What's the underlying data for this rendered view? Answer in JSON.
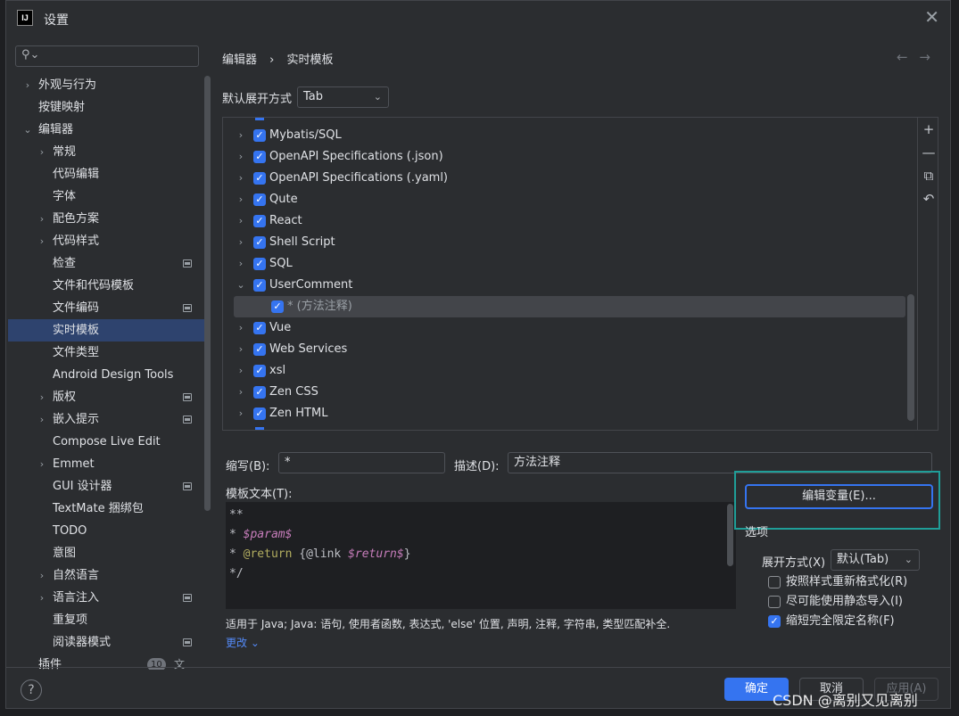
{
  "window": {
    "title": "设置",
    "app_icon_text": "IJ",
    "close_glyph": "✕"
  },
  "search": {
    "icon": "search-icon"
  },
  "sidebar": {
    "items": [
      {
        "label": "外观与行为",
        "chev": "›",
        "indent": 0,
        "proj": false
      },
      {
        "label": "按键映射",
        "chev": "",
        "indent": 0,
        "proj": false
      },
      {
        "label": "编辑器",
        "chev": "⌄",
        "indent": 0,
        "proj": false
      },
      {
        "label": "常规",
        "chev": "›",
        "indent": 1,
        "proj": false
      },
      {
        "label": "代码编辑",
        "chev": "",
        "indent": 1,
        "proj": false
      },
      {
        "label": "字体",
        "chev": "",
        "indent": 1,
        "proj": false
      },
      {
        "label": "配色方案",
        "chev": "›",
        "indent": 1,
        "proj": false
      },
      {
        "label": "代码样式",
        "chev": "›",
        "indent": 1,
        "proj": false
      },
      {
        "label": "检查",
        "chev": "",
        "indent": 1,
        "proj": true
      },
      {
        "label": "文件和代码模板",
        "chev": "",
        "indent": 1,
        "proj": false
      },
      {
        "label": "文件编码",
        "chev": "",
        "indent": 1,
        "proj": true
      },
      {
        "label": "实时模板",
        "chev": "",
        "indent": 1,
        "proj": false,
        "selected": true
      },
      {
        "label": "文件类型",
        "chev": "",
        "indent": 1,
        "proj": false
      },
      {
        "label": "Android Design Tools",
        "chev": "",
        "indent": 1,
        "proj": false
      },
      {
        "label": "版权",
        "chev": "›",
        "indent": 1,
        "proj": true
      },
      {
        "label": "嵌入提示",
        "chev": "›",
        "indent": 1,
        "proj": true
      },
      {
        "label": "Compose Live Edit",
        "chev": "",
        "indent": 1,
        "proj": false
      },
      {
        "label": "Emmet",
        "chev": "›",
        "indent": 1,
        "proj": false
      },
      {
        "label": "GUI 设计器",
        "chev": "",
        "indent": 1,
        "proj": true
      },
      {
        "label": "TextMate 捆绑包",
        "chev": "",
        "indent": 1,
        "proj": false
      },
      {
        "label": "TODO",
        "chev": "",
        "indent": 1,
        "proj": false
      },
      {
        "label": "意图",
        "chev": "",
        "indent": 1,
        "proj": false
      },
      {
        "label": "自然语言",
        "chev": "›",
        "indent": 1,
        "proj": false
      },
      {
        "label": "语言注入",
        "chev": "›",
        "indent": 1,
        "proj": true
      },
      {
        "label": "重复项",
        "chev": "",
        "indent": 1,
        "proj": false
      },
      {
        "label": "阅读器模式",
        "chev": "",
        "indent": 1,
        "proj": true
      },
      {
        "label": "插件",
        "chev": "",
        "indent": 0,
        "proj": false,
        "badge": "10",
        "extra": "文"
      }
    ]
  },
  "breadcrumb": {
    "parent": "编辑器",
    "separator": "›",
    "current": "实时模板"
  },
  "nav": {
    "back": "←",
    "forward": "→"
  },
  "expand": {
    "label": "默认展开方式",
    "value": "Tab",
    "arrow": "⌄"
  },
  "template_list": {
    "rows": [
      {
        "label": "Mybatis/SQL",
        "chev": "›",
        "level": 0
      },
      {
        "label": "OpenAPI Specifications (.json)",
        "chev": "›",
        "level": 0
      },
      {
        "label": "OpenAPI Specifications (.yaml)",
        "chev": "›",
        "level": 0
      },
      {
        "label": "Qute",
        "chev": "›",
        "level": 0
      },
      {
        "label": "React",
        "chev": "›",
        "level": 0
      },
      {
        "label": "Shell Script",
        "chev": "›",
        "level": 0
      },
      {
        "label": "SQL",
        "chev": "›",
        "level": 0
      },
      {
        "label": "UserComment",
        "chev": "⌄",
        "level": 0
      },
      {
        "label": "* (方法注释)",
        "chev": "",
        "level": 1,
        "selected": true
      },
      {
        "label": "Vue",
        "chev": "›",
        "level": 0
      },
      {
        "label": "Web Services",
        "chev": "›",
        "level": 0
      },
      {
        "label": "xsl",
        "chev": "›",
        "level": 0
      },
      {
        "label": "Zen CSS",
        "chev": "›",
        "level": 0
      },
      {
        "label": "Zen HTML",
        "chev": "›",
        "level": 0
      }
    ],
    "tools": [
      "+",
      "—",
      "⧉",
      "↶"
    ]
  },
  "abbreviation": {
    "label": "缩写(B):",
    "value": "*"
  },
  "description": {
    "label": "描述(D):",
    "value": "方法注释"
  },
  "template_text": {
    "label": "模板文本(T):",
    "lines": [
      [
        {
          "t": "**",
          "c": ""
        }
      ],
      [
        {
          "t": "* ",
          "c": ""
        },
        {
          "t": "$param$",
          "c": "c-var"
        }
      ],
      [
        {
          "t": "* ",
          "c": ""
        },
        {
          "t": "@return",
          "c": "c-ann"
        },
        {
          "t": " {@link ",
          "c": "c-link"
        },
        {
          "t": "$return$",
          "c": "c-var"
        },
        {
          "t": "}",
          "c": ""
        }
      ],
      [
        {
          "t": "*/",
          "c": ""
        }
      ]
    ]
  },
  "applicable": {
    "text": "适用于 Java; Java: 语句, 使用者函数, 表达式, 'else' 位置, 声明, 注释, 字符串, 类型匹配补全.",
    "change": "更改 ⌄"
  },
  "edit_vars": {
    "label": "编辑变量(E)..."
  },
  "options": {
    "title": "选项",
    "expand_label": "展开方式(X)",
    "expand_value": "默认(Tab)",
    "arrow": "⌄",
    "checks": [
      {
        "label": "按照样式重新格式化(R)",
        "checked": false
      },
      {
        "label": "尽可能使用静态导入(I)",
        "checked": false
      },
      {
        "label": "缩短完全限定名称(F)",
        "checked": true
      }
    ]
  },
  "footer": {
    "help": "?",
    "ok": "确定",
    "cancel": "取消",
    "apply": "应用(A)"
  },
  "watermark": "CSDN @离别又见离别",
  "colors": {
    "accent": "#3574f0",
    "highlight_frame": "#1f9e98",
    "selection": "#2e436e"
  }
}
